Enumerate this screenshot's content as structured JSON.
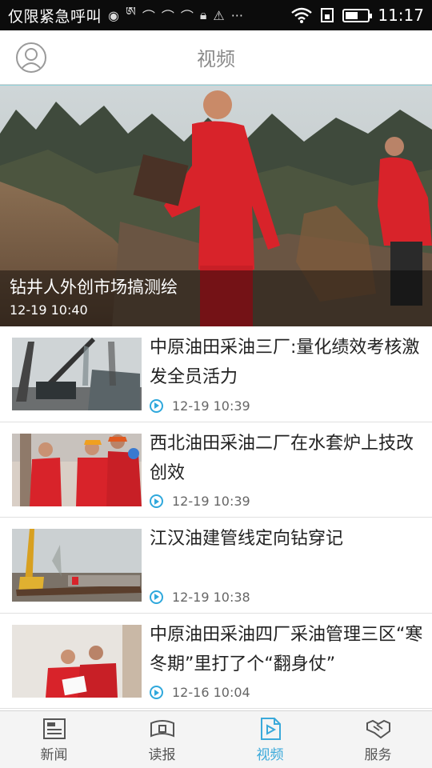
{
  "status_bar": {
    "carrier": "仅限紧急呼叫",
    "time": "11:17"
  },
  "header": {
    "title": "视频"
  },
  "hero": {
    "title": "钻井人外创市场搞测绘",
    "time": "12-19 10:40"
  },
  "news": [
    {
      "title": "中原油田采油三厂:量化绩效考核激发全员活力",
      "time": "12-19 10:39"
    },
    {
      "title": "西北油田采油二厂在水套炉上技改创效",
      "time": "12-19 10:39"
    },
    {
      "title": "江汉油建管线定向钻穿记",
      "time": "12-19 10:38"
    },
    {
      "title": "中原油田采油四厂采油管理三区“寒冬期”里打了个“翻身仗”",
      "time": "12-16 10:04"
    }
  ],
  "tabs": [
    {
      "label": "新闻",
      "icon": "newspaper-icon"
    },
    {
      "label": "读报",
      "icon": "reader-icon"
    },
    {
      "label": "视频",
      "icon": "video-icon"
    },
    {
      "label": "服务",
      "icon": "handshake-icon"
    }
  ],
  "active_tab_index": 2,
  "colors": {
    "accent": "#3aa9da",
    "workwear_red": "#d8232a"
  }
}
